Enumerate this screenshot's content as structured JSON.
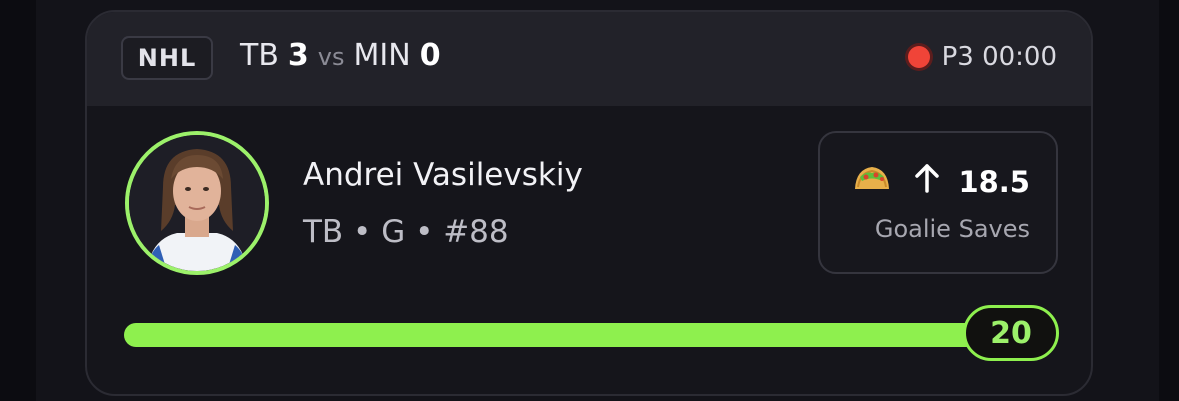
{
  "header": {
    "league": "NHL",
    "home_team": "TB",
    "home_score": "3",
    "vs": "vs",
    "away_team": "MIN",
    "away_score": "0",
    "status": "P3 00:00"
  },
  "player": {
    "name": "Andrei Vasilevskiy",
    "meta": "TB • G • #88"
  },
  "pick": {
    "icon": "taco-icon",
    "direction_icon": "arrow-up-icon",
    "line": "18.5",
    "stat": "Goalie Saves"
  },
  "progress": {
    "current_value": "20",
    "fill_fraction": 1.0
  },
  "colors": {
    "accent": "#8ef04e",
    "live": "#f04438",
    "card_bg": "#15151b",
    "header_bg": "#222229"
  }
}
